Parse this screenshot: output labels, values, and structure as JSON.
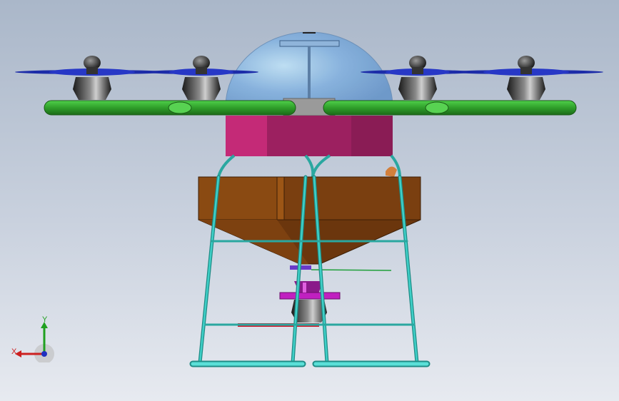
{
  "viewport": {
    "background_top": "#aab7c9",
    "background_bottom": "#e7eaf0"
  },
  "model": {
    "colors": {
      "dome": "#7fa9d8",
      "arm": "#3fb53a",
      "arm_dark": "#1e6f1a",
      "body_front": "#9c2060",
      "body_side": "#c42a77",
      "hopper": "#8a4a12",
      "hopper_dark": "#5a2e0a",
      "frame": "#3fc7c0",
      "propeller": "#1c2ca8",
      "motor": "#2a2a2a",
      "spreader": "#c020c0",
      "red_bar": "#d0182a",
      "feed_pipe": "#d27f3b"
    }
  },
  "triad": {
    "x_label": "X",
    "y_label": "Y",
    "x_color": "#cc2020",
    "y_color": "#20a020",
    "z_color": "#2030c0"
  }
}
